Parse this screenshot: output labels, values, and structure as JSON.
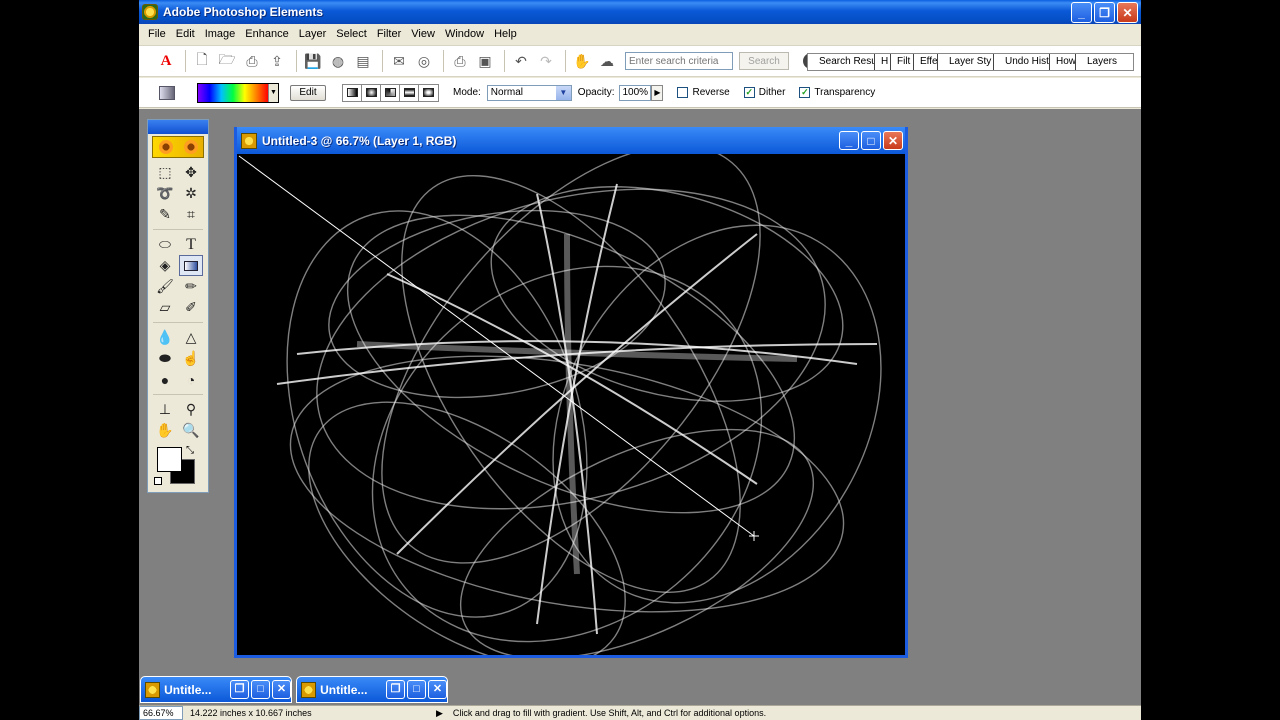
{
  "window": {
    "title": "Adobe Photoshop Elements",
    "app_icon": "sunflower-icon"
  },
  "menu": [
    "File",
    "Edit",
    "Image",
    "Enhance",
    "Layer",
    "Select",
    "Filter",
    "View",
    "Window",
    "Help"
  ],
  "toolbar": {
    "search_placeholder": "Enter search criteria",
    "search_button": "Search",
    "palette_tabs": [
      "Search Resu",
      "H",
      "Filt",
      "Effe",
      "Layer Sty",
      "Undo Histo",
      "How",
      "Layers"
    ]
  },
  "options": {
    "edit_label": "Edit",
    "mode_label": "Mode:",
    "mode_value": "Normal",
    "opacity_label": "Opacity:",
    "opacity_value": "100%",
    "reverse_label": "Reverse",
    "reverse_checked": false,
    "dither_label": "Dither",
    "dither_checked": true,
    "transparency_label": "Transparency",
    "transparency_checked": true
  },
  "document": {
    "title": "Untitled-3 @ 66.7% (Layer 1, RGB)"
  },
  "minimized_docs": [
    {
      "title": "Untitle..."
    },
    {
      "title": "Untitle..."
    }
  ],
  "status": {
    "zoom": "66.67%",
    "doc_size": "14.222 inches x 10.667 inches",
    "message": "Click and drag to fill with gradient.  Use Shift, Alt, and Ctrl for additional options."
  },
  "colors": {
    "foreground": "#ffffff",
    "background": "#000000",
    "titlebar": "#0c58d8"
  }
}
